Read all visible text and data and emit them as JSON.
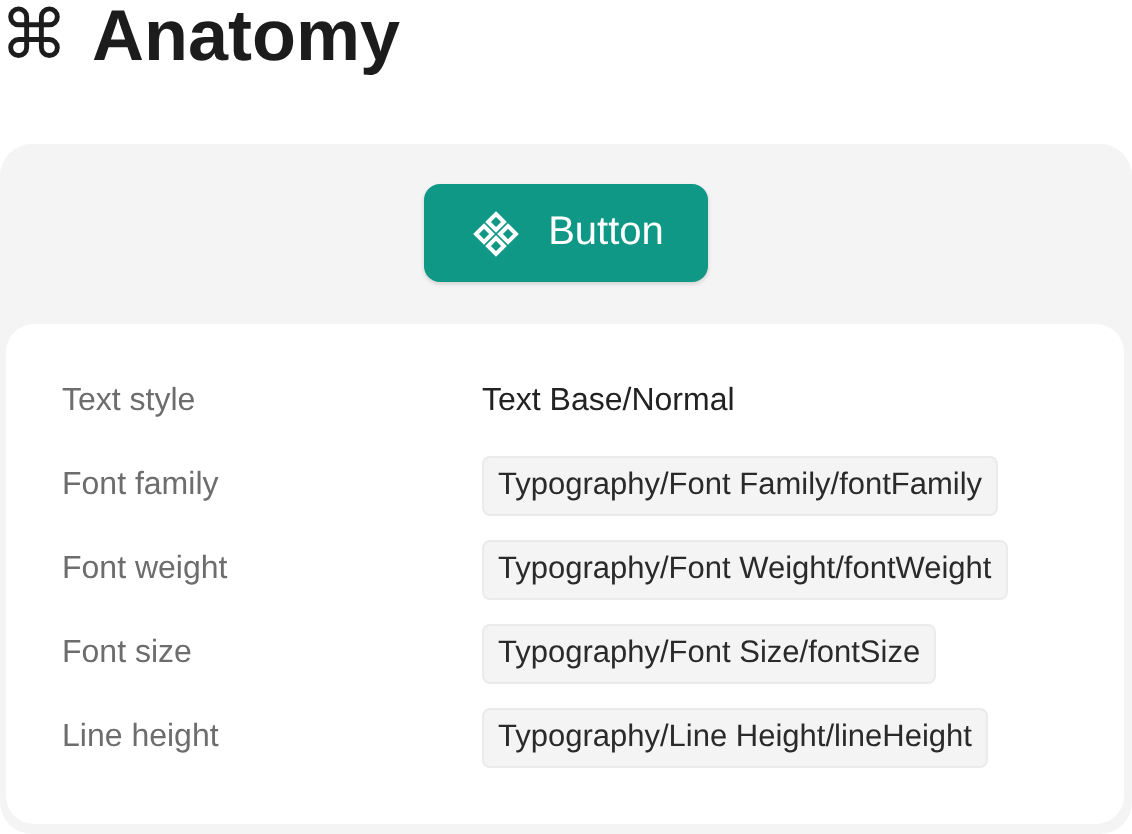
{
  "title": {
    "icon": "⌘",
    "text": "Anatomy"
  },
  "preview": {
    "button": {
      "label": "Button"
    }
  },
  "properties": [
    {
      "label": "Text style",
      "kind": "text",
      "value": "Text Base/Normal"
    },
    {
      "label": "Font family",
      "kind": "token",
      "value": "Typography/Font Family/fontFamily"
    },
    {
      "label": "Font weight",
      "kind": "token",
      "value": "Typography/Font Weight/fontWeight"
    },
    {
      "label": "Font size",
      "kind": "token",
      "value": "Typography/Font Size/fontSize"
    },
    {
      "label": "Line height",
      "kind": "token",
      "value": "Typography/Line Height/lineHeight"
    }
  ]
}
